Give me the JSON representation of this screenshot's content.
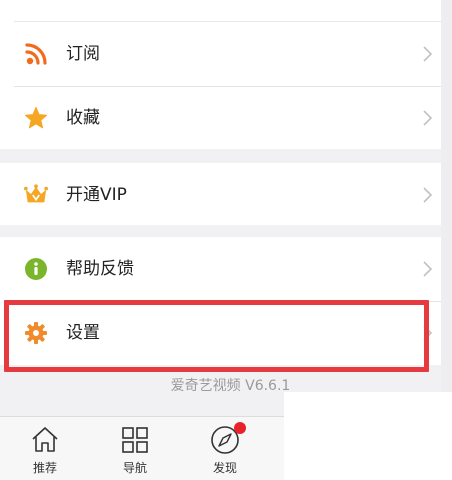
{
  "menu": {
    "subscribe_label": "订阅",
    "favorites_label": "收藏",
    "vip_label": "开通VIP",
    "help_label": "帮助反馈",
    "settings_label": "设置"
  },
  "version_text": "爱奇艺视频 V6.6.1",
  "tabs": [
    {
      "label": "推荐",
      "icon": "home-icon"
    },
    {
      "label": "导航",
      "icon": "grid-icon"
    },
    {
      "label": "发现",
      "icon": "compass-icon"
    }
  ],
  "colors": {
    "subscribe": "#f26b1d",
    "star": "#f5a623",
    "crown": "#f5a623",
    "help": "#7bb52c",
    "settings": "#f08a2a",
    "highlight": "#e53a3f",
    "badge": "#e8212b"
  }
}
